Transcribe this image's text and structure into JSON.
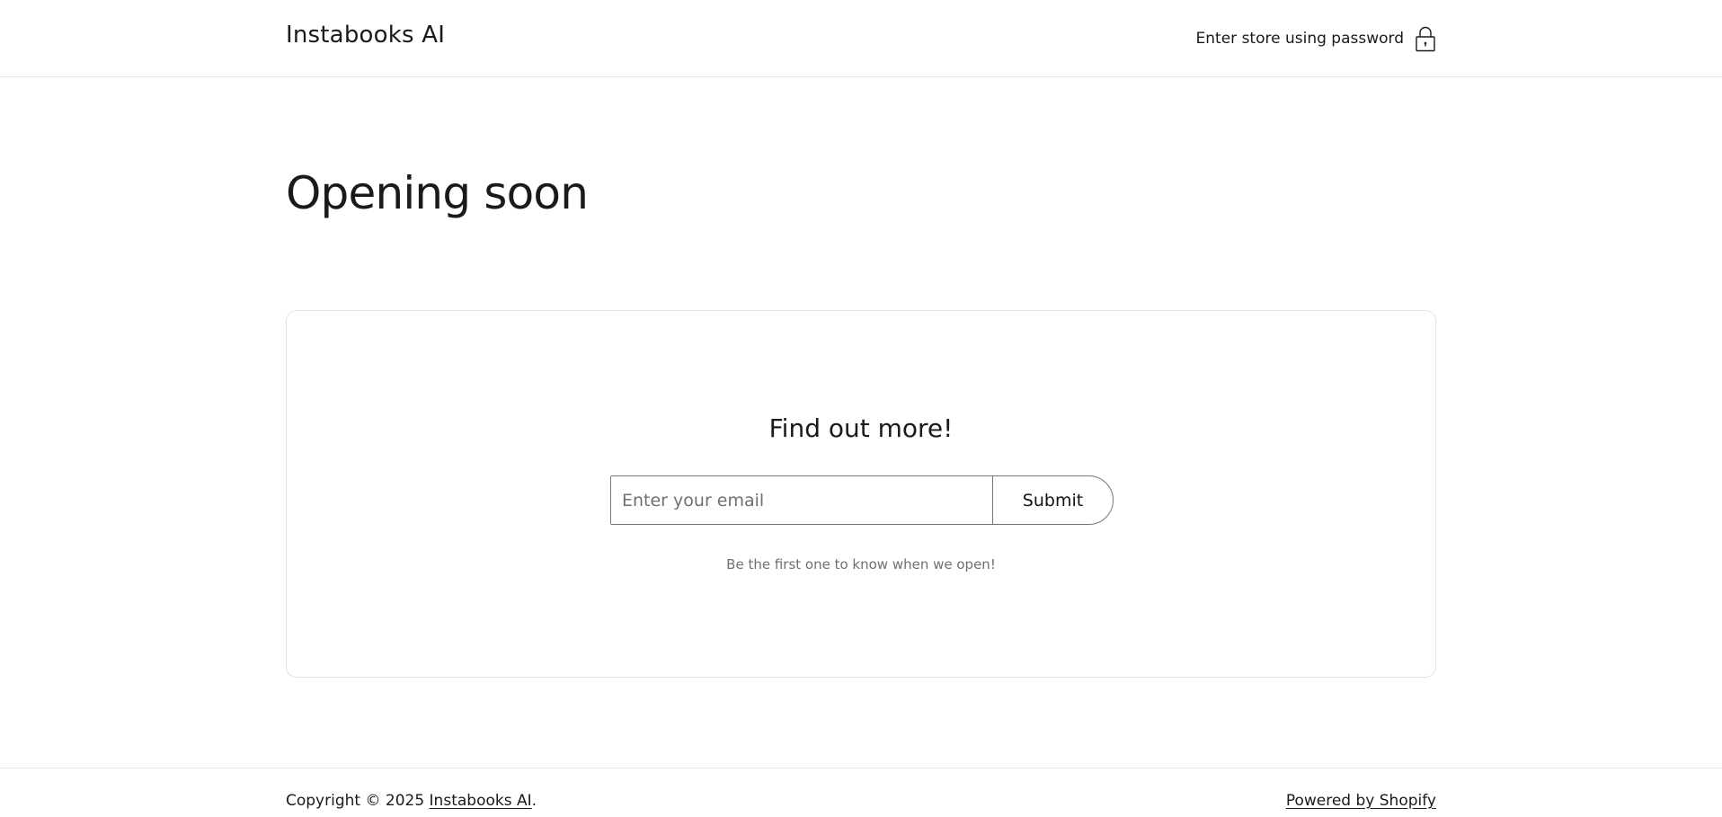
{
  "header": {
    "brand": "Instabooks AI",
    "password_link": "Enter store using password",
    "icon": "lock-icon"
  },
  "main": {
    "headline": "Opening soon",
    "card": {
      "title": "Find out more!",
      "email_placeholder": "Enter your email",
      "submit_label": "Submit",
      "note": "Be the first one to know when we open!"
    }
  },
  "footer": {
    "copyright_prefix": "Copyright © 2025 ",
    "copyright_link": "Instabooks AI",
    "copyright_suffix": ".",
    "powered_by": "Powered by Shopify"
  }
}
